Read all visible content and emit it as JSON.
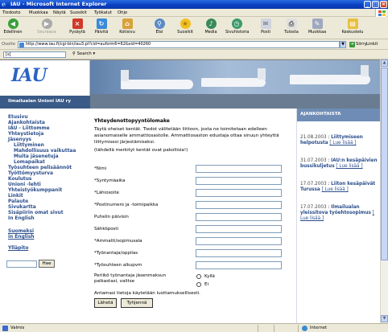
{
  "window": {
    "title": "IAU - Microsoft Internet Explorer"
  },
  "menu": [
    "Tiedosto",
    "Muokkaa",
    "Näytä",
    "Suosikit",
    "Työkalut",
    "Ohje"
  ],
  "toolbar": {
    "back": "Edellinen",
    "forward": "Seuraava",
    "stop": "Pysäytä",
    "refresh": "Päivitä",
    "home": "Kotisivu",
    "search": "Etsi",
    "favorites": "Suosikit",
    "media": "Media",
    "history": "Sivuhistoria",
    "mail": "Posti",
    "print": "Tulosta",
    "edit": "Muokkaa",
    "discuss": "Keskustelu"
  },
  "address": {
    "label": "Osoite",
    "url": "http://www.iau.fi/cgi-bin/iau3.pl?cid=auform6=62&sid=40260",
    "go": "Siirry",
    "links": "Linkit"
  },
  "searchbar": {
    "field": "[s]",
    "button": "Search"
  },
  "site": {
    "logo": "IAU",
    "org_name": "Ilmailualan Unioni IAU ry",
    "nav": [
      {
        "label": "Etusivu",
        "sub": false
      },
      {
        "label": "Ajankohtaista",
        "sub": false
      },
      {
        "label": "IAU - Liittomme",
        "sub": false
      },
      {
        "label": "Yhteystietoja",
        "sub": false
      },
      {
        "label": "Jäsenyys",
        "sub": false
      },
      {
        "label": "Liittyminen",
        "sub": true
      },
      {
        "label": "Mahdollisuus vaikuttaa",
        "sub": true
      },
      {
        "label": "Muita jäsenetuja",
        "sub": true
      },
      {
        "label": "Lomapaikat",
        "sub": true
      },
      {
        "label": "Työsuhteen pelisäännöt",
        "sub": false
      },
      {
        "label": "Työttömyysturva",
        "sub": false
      },
      {
        "label": "Koulutus",
        "sub": false
      },
      {
        "label": "Unioni -lehti",
        "sub": false
      },
      {
        "label": "Yhteistyökumppanit",
        "sub": false
      },
      {
        "label": "Linkit",
        "sub": false
      },
      {
        "label": "Palaute",
        "sub": false
      },
      {
        "label": "Sivukartta",
        "sub": false
      },
      {
        "label": "Sisäpiirin omat sivut",
        "sub": false
      },
      {
        "label": "In English",
        "sub": false
      }
    ],
    "lang_links": [
      "Suomeksi",
      "in English"
    ],
    "admin_link": "Ylläpito",
    "search_button": "Hae"
  },
  "form": {
    "heading": "Yhteydenottopyyntölomake",
    "intro": "Täytä oheiset kentät. Tiedot välitetään liittoon, josta ne toimitetaan edelleen asianomaiselle ammattiosastolle. Ammattiosaston edustaja ottaa sinuun yhteyttä liittymisesi järjestämiseksi.",
    "required_note": "(tähdellä merkityt kentät ovat pakollisia!)",
    "fields": [
      "*Nimi",
      "*Syntymäaika",
      "*Lähiosoite",
      "*Postinumero ja -toimipaikka",
      "Puhelin päivisin",
      "Sähköposti",
      "*Ammatti/sopimusala",
      "*Työnantaja/oppilas",
      "*Työsuhteen alkupvm"
    ],
    "deduction_question": "Periikö työnantaja jäsenmaksun palkastasi, valitse",
    "options": [
      "Kyllä",
      "Ei"
    ],
    "confidential_note": "Antamasi tietoja käytetään luottamuksellisesti.",
    "submit": "Lähetä",
    "reset": "Tyhjennä"
  },
  "news": {
    "heading": "AJANKOHTAISTA",
    "items": [
      {
        "date": "21.08.2003",
        "title": "Liittymiseen helpotusta",
        "more": "[ Lue lisää ]"
      },
      {
        "date": "31.07.2003",
        "title": "IAU:n kesäpäivien bussikuljetus",
        "more": "[ Lue lisää ]"
      },
      {
        "date": "17.07.2003",
        "title": "Liiton kesäpäivät Turussa",
        "more": "[ Lue lisää ]"
      },
      {
        "date": "17.07.2003",
        "title": "Ilmailualan yleissitova työehtosopimus",
        "more": "[ Lue lisää ]"
      }
    ]
  },
  "status": {
    "text": "Valmis",
    "zone": "Internet"
  }
}
